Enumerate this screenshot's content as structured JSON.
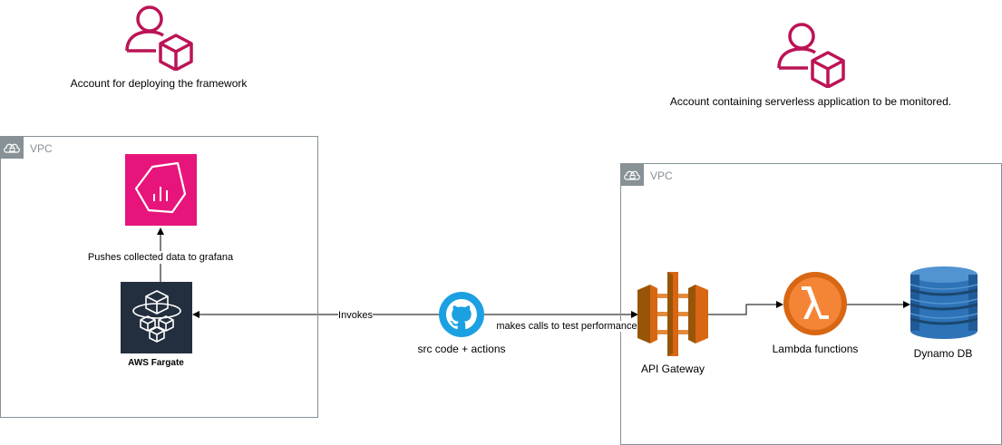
{
  "accounts": {
    "deploy": "Account for deploying the framework",
    "monitored": "Account containing serverless application  to be monitored."
  },
  "vpc": {
    "left_label": "VPC",
    "right_label": "VPC"
  },
  "nodes": {
    "grafana": {
      "icon": "grafana-icon"
    },
    "fargate": {
      "label": "AWS Fargate",
      "icon": "fargate-icon"
    },
    "github": {
      "label": "src code + actions",
      "icon": "github-icon"
    },
    "api_gateway": {
      "label": "API Gateway",
      "icon": "api-gateway-icon"
    },
    "lambda": {
      "label": "Lambda functions",
      "icon": "lambda-icon"
    },
    "dynamodb": {
      "label": "Dynamo DB",
      "icon": "dynamodb-icon"
    }
  },
  "edges": {
    "fargate_to_grafana": "Pushes collected data to grafana",
    "github_to_fargate": "Invokes",
    "github_to_api": "makes calls to test performance"
  },
  "colors": {
    "account_icon": "#BC1356",
    "grafana_bg": "#E7157B",
    "fargate_bg": "#232F3E",
    "github": "#1BA1E2",
    "aws_orange": "#D86613",
    "dynamo_blue": "#2E73B8",
    "vpc_gray": "#879196"
  }
}
